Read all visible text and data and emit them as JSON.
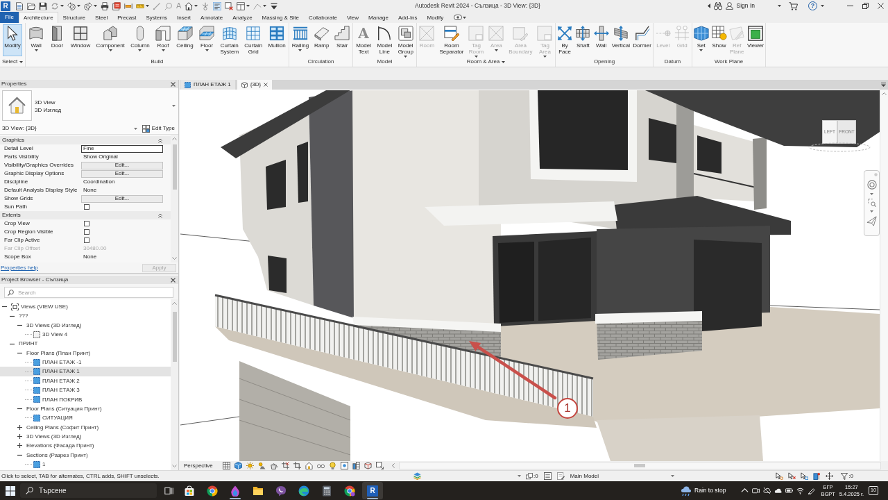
{
  "window": {
    "logo": "R",
    "title": "Autodesk Revit 2024 - Сълзица - 3D View: {3D}",
    "sign_in": "Sign In",
    "help": "?"
  },
  "quick_access": {
    "text_button": "A"
  },
  "tabs": [
    {
      "label": "File",
      "kind": "file",
      "selected": false
    },
    {
      "label": "Architecture",
      "kind": "tab",
      "selected": true
    },
    {
      "label": "Structure",
      "kind": "tab",
      "selected": false
    },
    {
      "label": "Steel",
      "kind": "tab",
      "selected": false
    },
    {
      "label": "Precast",
      "kind": "tab",
      "selected": false
    },
    {
      "label": "Systems",
      "kind": "tab",
      "selected": false
    },
    {
      "label": "Insert",
      "kind": "tab",
      "selected": false
    },
    {
      "label": "Annotate",
      "kind": "tab",
      "selected": false
    },
    {
      "label": "Analyze",
      "kind": "tab",
      "selected": false
    },
    {
      "label": "Massing & Site",
      "kind": "tab",
      "selected": false
    },
    {
      "label": "Collaborate",
      "kind": "tab",
      "selected": false
    },
    {
      "label": "View",
      "kind": "tab",
      "selected": false
    },
    {
      "label": "Manage",
      "kind": "tab",
      "selected": false
    },
    {
      "label": "Add-Ins",
      "kind": "tab",
      "selected": false
    },
    {
      "label": "Modify",
      "kind": "tab",
      "selected": false
    }
  ],
  "ribbon": {
    "panels": [
      {
        "label": "Select",
        "menu": true,
        "tools": [
          {
            "label": "Modify",
            "selected": true,
            "disabled": false,
            "dropdown": false
          }
        ]
      },
      {
        "label": "Build",
        "menu": false,
        "tools": [
          {
            "label": "Wall",
            "selected": false,
            "disabled": false,
            "dropdown": true
          },
          {
            "label": "Door",
            "selected": false,
            "disabled": false,
            "dropdown": false
          },
          {
            "label": "Window",
            "selected": false,
            "disabled": false,
            "dropdown": false
          },
          {
            "label": "Component",
            "selected": false,
            "disabled": false,
            "dropdown": true
          },
          {
            "label": "Column",
            "selected": false,
            "disabled": false,
            "dropdown": true
          },
          {
            "label": "Roof",
            "selected": false,
            "disabled": false,
            "dropdown": true
          },
          {
            "label": "Ceiling",
            "selected": false,
            "disabled": false,
            "dropdown": false
          },
          {
            "label": "Floor",
            "selected": false,
            "disabled": false,
            "dropdown": true
          },
          {
            "label": "Curtain\nSystem",
            "selected": false,
            "disabled": false,
            "dropdown": false
          },
          {
            "label": "Curtain\nGrid",
            "selected": false,
            "disabled": false,
            "dropdown": false
          },
          {
            "label": "Mullion",
            "selected": false,
            "disabled": false,
            "dropdown": false
          }
        ]
      },
      {
        "label": "Circulation",
        "menu": false,
        "tools": [
          {
            "label": "Railing",
            "selected": false,
            "disabled": false,
            "dropdown": true
          },
          {
            "label": "Ramp",
            "selected": false,
            "disabled": false,
            "dropdown": false
          },
          {
            "label": "Stair",
            "selected": false,
            "disabled": false,
            "dropdown": false
          }
        ]
      },
      {
        "label": "Model",
        "menu": false,
        "tools": [
          {
            "label": "Model\nText",
            "glyph": "A",
            "selected": false,
            "disabled": false,
            "dropdown": false
          },
          {
            "label": "Model\nLine",
            "selected": false,
            "disabled": false,
            "dropdown": false
          },
          {
            "label": "Model\nGroup",
            "selected": false,
            "disabled": false,
            "dropdown": true
          }
        ]
      },
      {
        "label": "Room & Area",
        "menu": true,
        "tools": [
          {
            "label": "Room",
            "selected": false,
            "disabled": true,
            "dropdown": false
          },
          {
            "label": "Room\nSeparator",
            "selected": false,
            "disabled": false,
            "dropdown": false
          },
          {
            "label": "Tag\nRoom",
            "selected": false,
            "disabled": true,
            "dropdown": true
          },
          {
            "label": "Area",
            "selected": false,
            "disabled": true,
            "dropdown": true
          },
          {
            "label": "Area\nBoundary",
            "selected": false,
            "disabled": true,
            "dropdown": false
          },
          {
            "label": "Tag\nArea",
            "selected": false,
            "disabled": true,
            "dropdown": true
          }
        ]
      },
      {
        "label": "Opening",
        "menu": false,
        "tools": [
          {
            "label": "By\nFace",
            "selected": false,
            "disabled": false,
            "dropdown": false
          },
          {
            "label": "Shaft",
            "selected": false,
            "disabled": false,
            "dropdown": false
          },
          {
            "label": "Wall",
            "selected": false,
            "disabled": false,
            "dropdown": false
          },
          {
            "label": "Vertical",
            "selected": false,
            "disabled": false,
            "dropdown": false
          },
          {
            "label": "Dormer",
            "selected": false,
            "disabled": false,
            "dropdown": false
          }
        ]
      },
      {
        "label": "Datum",
        "menu": false,
        "tools": [
          {
            "label": "Level",
            "selected": false,
            "disabled": true,
            "dropdown": false
          },
          {
            "label": "Grid",
            "selected": false,
            "disabled": true,
            "dropdown": false
          }
        ]
      },
      {
        "label": "Work Plane",
        "menu": false,
        "tools": [
          {
            "label": "Set",
            "selected": false,
            "disabled": false,
            "dropdown": true
          },
          {
            "label": "Show",
            "selected": false,
            "disabled": false,
            "dropdown": false
          },
          {
            "label": "Ref\nPlane",
            "selected": false,
            "disabled": true,
            "dropdown": false
          },
          {
            "label": "Viewer",
            "selected": false,
            "disabled": false,
            "dropdown": false
          }
        ]
      }
    ]
  },
  "properties": {
    "title": "Properties",
    "type": {
      "name": "3D View",
      "subname": "3D Изглед"
    },
    "instance": "3D View: {3D}",
    "edit_type": "Edit Type",
    "groups": [
      {
        "label": "Graphics",
        "expanded": true,
        "rows": [
          {
            "label": "Detail Level",
            "kind": "field",
            "value": "Fine",
            "disabled": false
          },
          {
            "label": "Parts Visibility",
            "kind": "text",
            "value": "Show Original",
            "disabled": false
          },
          {
            "label": "Visibility/Graphics Overrides",
            "kind": "button",
            "value": "Edit...",
            "disabled": false
          },
          {
            "label": "Graphic Display Options",
            "kind": "button",
            "value": "Edit...",
            "disabled": false
          },
          {
            "label": "Discipline",
            "kind": "text",
            "value": "Coordination",
            "disabled": false
          },
          {
            "label": "Default Analysis Display Style",
            "kind": "text",
            "value": "None",
            "disabled": false
          },
          {
            "label": "Show Grids",
            "kind": "button",
            "value": "Edit...",
            "disabled": false
          },
          {
            "label": "Sun Path",
            "kind": "checkbox",
            "checked": false,
            "disabled": false
          }
        ]
      },
      {
        "label": "Extents",
        "expanded": true,
        "rows": [
          {
            "label": "Crop View",
            "kind": "checkbox",
            "checked": false,
            "disabled": false
          },
          {
            "label": "Crop Region Visible",
            "kind": "checkbox",
            "checked": false,
            "disabled": false
          },
          {
            "label": "Far Clip Active",
            "kind": "checkbox",
            "checked": false,
            "disabled": false
          },
          {
            "label": "Far Clip Offset",
            "kind": "text",
            "value": "30480.00",
            "disabled": true
          },
          {
            "label": "Scope Box",
            "kind": "text",
            "value": "None",
            "disabled": false
          }
        ]
      }
    ],
    "help": "Properties help",
    "apply": {
      "label": "Apply",
      "disabled": true
    }
  },
  "project_browser": {
    "title": "Project Browser - Сълзица",
    "search": {
      "placeholder": "Search"
    },
    "tree": [
      {
        "label": "Views (VIEW USE)",
        "kind": "root",
        "expanded": true,
        "selected": false,
        "children": [
          {
            "label": "???",
            "kind": "group",
            "expanded": true,
            "selected": false,
            "children": [
              {
                "label": "3D Views (3D Изглед)",
                "kind": "group",
                "expanded": true,
                "selected": false,
                "children": [
                  {
                    "label": "3D View 4",
                    "kind": "view3d",
                    "selected": false
                  }
                ]
              }
            ]
          },
          {
            "label": "ПРИНТ",
            "kind": "group",
            "expanded": true,
            "selected": false,
            "children": [
              {
                "label": "Floor Plans (План Принт)",
                "kind": "group",
                "expanded": true,
                "selected": false,
                "children": [
                  {
                    "label": "ПЛАН ЕТАЖ -1",
                    "kind": "plan",
                    "selected": false
                  },
                  {
                    "label": "ПЛАН ЕТАЖ 1",
                    "kind": "plan",
                    "selected": true
                  },
                  {
                    "label": "ПЛАН ЕТАЖ 2",
                    "kind": "plan",
                    "selected": false
                  },
                  {
                    "label": "ПЛАН ЕТАЖ 3",
                    "kind": "plan",
                    "selected": false
                  },
                  {
                    "label": "ПЛАН ПОКРИВ",
                    "kind": "plan",
                    "selected": false
                  }
                ]
              },
              {
                "label": "Floor Plans (Ситуация Принт)",
                "kind": "group",
                "expanded": true,
                "selected": false,
                "children": [
                  {
                    "label": "СИТУАЦИЯ",
                    "kind": "plan",
                    "selected": false
                  }
                ]
              },
              {
                "label": "Ceiling Plans (Софит Принт)",
                "kind": "group",
                "expanded": false,
                "selected": false
              },
              {
                "label": "3D Views (3D Изглед)",
                "kind": "group",
                "expanded": false,
                "selected": false
              },
              {
                "label": "Elevations (Фасада Принт)",
                "kind": "group",
                "expanded": false,
                "selected": false
              },
              {
                "label": "Sections (Разрез Принт)",
                "kind": "group",
                "expanded": true,
                "selected": false,
                "children": [
                  {
                    "label": "1",
                    "kind": "plan",
                    "selected": false
                  }
                ]
              }
            ]
          }
        ]
      }
    ]
  },
  "view": {
    "tabs": [
      {
        "label": "ПЛАН ЕТАЖ 1",
        "kind": "plan",
        "selected": false
      },
      {
        "label": "{3D}",
        "kind": "model",
        "selected": true
      }
    ],
    "view_cube": {
      "faces": [
        "LEFT",
        "FRONT"
      ]
    },
    "callout": "1",
    "control_bar": {
      "mode": "Perspective"
    }
  },
  "status_bar": {
    "message": "Click to select, TAB for alternates, CTRL adds, SHIFT unselects.",
    "options_count": ":0",
    "model": "Main Model",
    "filter_count": ":0"
  },
  "taskbar": {
    "search": {
      "placeholder": "Търсене"
    },
    "apps": [
      {
        "selected": false,
        "running": false
      },
      {
        "selected": false,
        "running": false
      },
      {
        "selected": false,
        "running": true
      },
      {
        "selected": false,
        "running": false
      },
      {
        "selected": false,
        "running": false
      },
      {
        "selected": false,
        "running": false
      },
      {
        "selected": false,
        "running": false
      },
      {
        "selected": false,
        "running": false
      },
      {
        "selected": true,
        "running": true,
        "letter": "R"
      }
    ],
    "weather": "Rain to stop",
    "language": "БГР",
    "layout": "BGPT",
    "time": "15:27",
    "date": "5.4.2025 г.",
    "notifications": "10"
  }
}
